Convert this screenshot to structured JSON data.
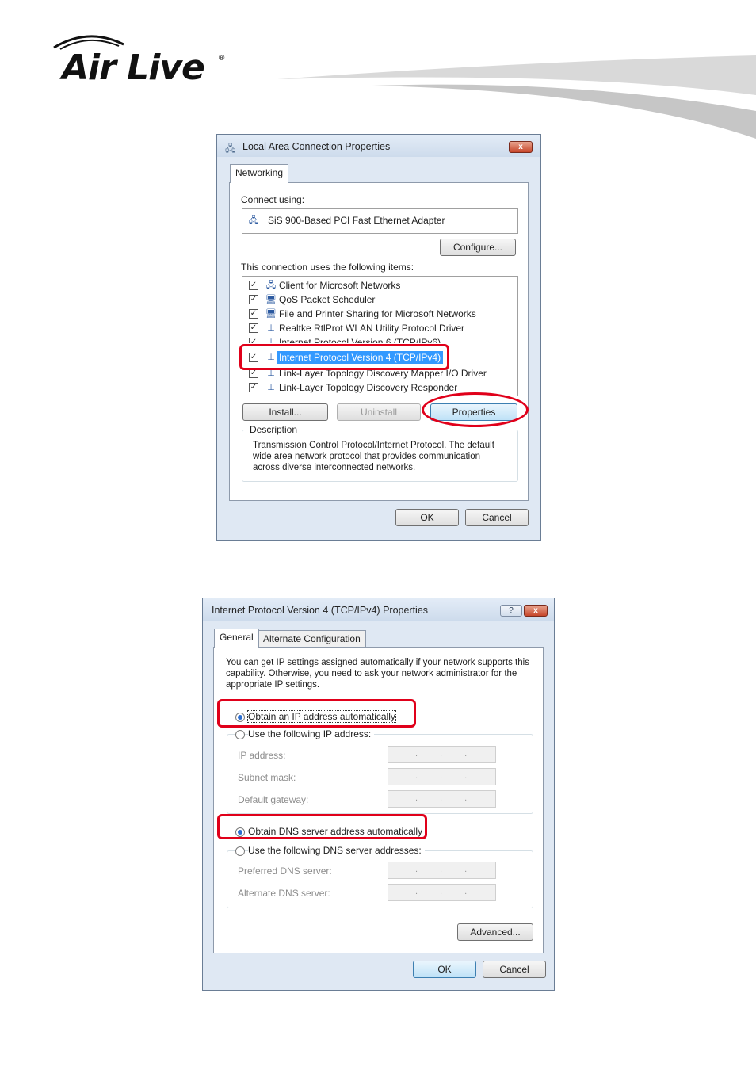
{
  "brand": {
    "logo_text": "Air Live",
    "registered": "®"
  },
  "dialog1": {
    "title": "Local Area Connection Properties",
    "close_glyph": "x",
    "tab": "Networking",
    "connect_using_label": "Connect using:",
    "adapter": "SiS 900-Based PCI Fast Ethernet Adapter",
    "configure_button": "Configure...",
    "items_label": "This connection uses the following items:",
    "items": [
      {
        "label": "Client for Microsoft Networks",
        "checked": true
      },
      {
        "label": "QoS Packet Scheduler",
        "checked": true
      },
      {
        "label": "File and Printer Sharing for Microsoft Networks",
        "checked": true
      },
      {
        "label": "Realtke RtlProt WLAN Utility Protocol Driver",
        "checked": true
      },
      {
        "label": "Internet Protocol Version 6 (TCP/IPv6)",
        "checked": true
      },
      {
        "label": "Internet Protocol Version 4 (TCP/IPv4)",
        "checked": true
      },
      {
        "label": "Link-Layer Topology Discovery Mapper I/O Driver",
        "checked": true
      },
      {
        "label": "Link-Layer Topology Discovery Responder",
        "checked": true
      }
    ],
    "install_button": "Install...",
    "uninstall_button": "Uninstall",
    "properties_button": "Properties",
    "description_label": "Description",
    "description_text": "Transmission Control Protocol/Internet Protocol. The default wide area network protocol that provides communication across diverse interconnected networks.",
    "ok_button": "OK",
    "cancel_button": "Cancel"
  },
  "dialog2": {
    "title": "Internet Protocol Version 4 (TCP/IPv4) Properties",
    "help_glyph": "?",
    "close_glyph": "x",
    "tabs": [
      "General",
      "Alternate Configuration"
    ],
    "intro": "You can get IP settings assigned automatically if your network supports this capability. Otherwise, you need to ask your network administrator for the appropriate IP settings.",
    "obtain_ip_auto": "Obtain an IP address automatically",
    "use_following_ip": "Use the following IP address:",
    "ip_address_label": "IP address:",
    "subnet_mask_label": "Subnet mask:",
    "default_gateway_label": "Default gateway:",
    "ip_placeholder": "...",
    "obtain_dns_auto": "Obtain DNS server address automatically",
    "use_following_dns": "Use the following DNS server addresses:",
    "preferred_dns_label": "Preferred DNS server:",
    "alternate_dns_label": "Alternate DNS server:",
    "advanced_button": "Advanced...",
    "ok_button": "OK",
    "cancel_button": "Cancel"
  },
  "colors": {
    "highlight_red": "#e0001a",
    "selection_blue": "#3399ff"
  }
}
